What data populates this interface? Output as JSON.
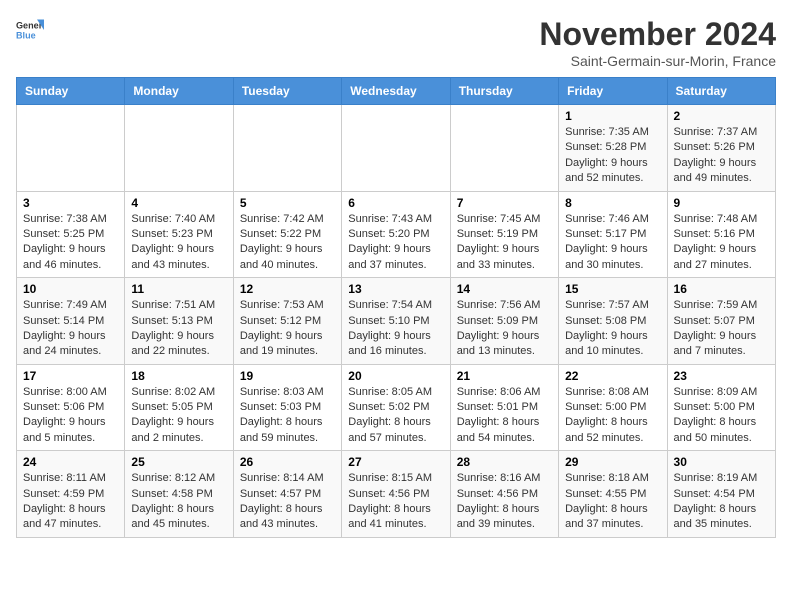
{
  "logo": {
    "general": "General",
    "blue": "Blue"
  },
  "title": "November 2024",
  "subtitle": "Saint-Germain-sur-Morin, France",
  "days_of_week": [
    "Sunday",
    "Monday",
    "Tuesday",
    "Wednesday",
    "Thursday",
    "Friday",
    "Saturday"
  ],
  "weeks": [
    [
      {
        "day": "",
        "info": ""
      },
      {
        "day": "",
        "info": ""
      },
      {
        "day": "",
        "info": ""
      },
      {
        "day": "",
        "info": ""
      },
      {
        "day": "",
        "info": ""
      },
      {
        "day": "1",
        "info": "Sunrise: 7:35 AM\nSunset: 5:28 PM\nDaylight: 9 hours and 52 minutes."
      },
      {
        "day": "2",
        "info": "Sunrise: 7:37 AM\nSunset: 5:26 PM\nDaylight: 9 hours and 49 minutes."
      }
    ],
    [
      {
        "day": "3",
        "info": "Sunrise: 7:38 AM\nSunset: 5:25 PM\nDaylight: 9 hours and 46 minutes."
      },
      {
        "day": "4",
        "info": "Sunrise: 7:40 AM\nSunset: 5:23 PM\nDaylight: 9 hours and 43 minutes."
      },
      {
        "day": "5",
        "info": "Sunrise: 7:42 AM\nSunset: 5:22 PM\nDaylight: 9 hours and 40 minutes."
      },
      {
        "day": "6",
        "info": "Sunrise: 7:43 AM\nSunset: 5:20 PM\nDaylight: 9 hours and 37 minutes."
      },
      {
        "day": "7",
        "info": "Sunrise: 7:45 AM\nSunset: 5:19 PM\nDaylight: 9 hours and 33 minutes."
      },
      {
        "day": "8",
        "info": "Sunrise: 7:46 AM\nSunset: 5:17 PM\nDaylight: 9 hours and 30 minutes."
      },
      {
        "day": "9",
        "info": "Sunrise: 7:48 AM\nSunset: 5:16 PM\nDaylight: 9 hours and 27 minutes."
      }
    ],
    [
      {
        "day": "10",
        "info": "Sunrise: 7:49 AM\nSunset: 5:14 PM\nDaylight: 9 hours and 24 minutes."
      },
      {
        "day": "11",
        "info": "Sunrise: 7:51 AM\nSunset: 5:13 PM\nDaylight: 9 hours and 22 minutes."
      },
      {
        "day": "12",
        "info": "Sunrise: 7:53 AM\nSunset: 5:12 PM\nDaylight: 9 hours and 19 minutes."
      },
      {
        "day": "13",
        "info": "Sunrise: 7:54 AM\nSunset: 5:10 PM\nDaylight: 9 hours and 16 minutes."
      },
      {
        "day": "14",
        "info": "Sunrise: 7:56 AM\nSunset: 5:09 PM\nDaylight: 9 hours and 13 minutes."
      },
      {
        "day": "15",
        "info": "Sunrise: 7:57 AM\nSunset: 5:08 PM\nDaylight: 9 hours and 10 minutes."
      },
      {
        "day": "16",
        "info": "Sunrise: 7:59 AM\nSunset: 5:07 PM\nDaylight: 9 hours and 7 minutes."
      }
    ],
    [
      {
        "day": "17",
        "info": "Sunrise: 8:00 AM\nSunset: 5:06 PM\nDaylight: 9 hours and 5 minutes."
      },
      {
        "day": "18",
        "info": "Sunrise: 8:02 AM\nSunset: 5:05 PM\nDaylight: 9 hours and 2 minutes."
      },
      {
        "day": "19",
        "info": "Sunrise: 8:03 AM\nSunset: 5:03 PM\nDaylight: 8 hours and 59 minutes."
      },
      {
        "day": "20",
        "info": "Sunrise: 8:05 AM\nSunset: 5:02 PM\nDaylight: 8 hours and 57 minutes."
      },
      {
        "day": "21",
        "info": "Sunrise: 8:06 AM\nSunset: 5:01 PM\nDaylight: 8 hours and 54 minutes."
      },
      {
        "day": "22",
        "info": "Sunrise: 8:08 AM\nSunset: 5:00 PM\nDaylight: 8 hours and 52 minutes."
      },
      {
        "day": "23",
        "info": "Sunrise: 8:09 AM\nSunset: 5:00 PM\nDaylight: 8 hours and 50 minutes."
      }
    ],
    [
      {
        "day": "24",
        "info": "Sunrise: 8:11 AM\nSunset: 4:59 PM\nDaylight: 8 hours and 47 minutes."
      },
      {
        "day": "25",
        "info": "Sunrise: 8:12 AM\nSunset: 4:58 PM\nDaylight: 8 hours and 45 minutes."
      },
      {
        "day": "26",
        "info": "Sunrise: 8:14 AM\nSunset: 4:57 PM\nDaylight: 8 hours and 43 minutes."
      },
      {
        "day": "27",
        "info": "Sunrise: 8:15 AM\nSunset: 4:56 PM\nDaylight: 8 hours and 41 minutes."
      },
      {
        "day": "28",
        "info": "Sunrise: 8:16 AM\nSunset: 4:56 PM\nDaylight: 8 hours and 39 minutes."
      },
      {
        "day": "29",
        "info": "Sunrise: 8:18 AM\nSunset: 4:55 PM\nDaylight: 8 hours and 37 minutes."
      },
      {
        "day": "30",
        "info": "Sunrise: 8:19 AM\nSunset: 4:54 PM\nDaylight: 8 hours and 35 minutes."
      }
    ]
  ]
}
